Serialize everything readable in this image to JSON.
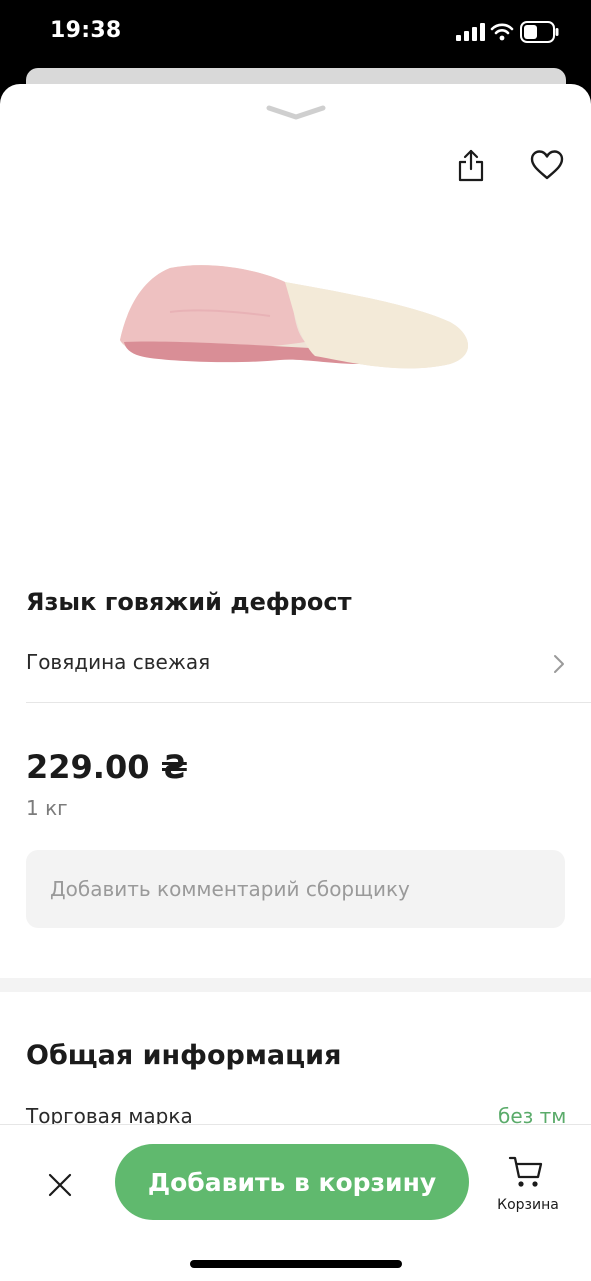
{
  "status": {
    "time": "19:38"
  },
  "product": {
    "title": "Язык говяжий дефрост",
    "category": "Говядина свежая",
    "price": "229.00 ₴",
    "unit": "1 кг",
    "comment_placeholder": "Добавить комментарий сборщику"
  },
  "info": {
    "title": "Общая информация",
    "brand_label": "Торговая марка",
    "brand_value": "без тм"
  },
  "bottom": {
    "add_to_cart": "Добавить в корзину",
    "cart_label": "Корзина"
  },
  "icons": {
    "share": "share-icon",
    "favorite": "heart-icon",
    "close": "close-icon",
    "cart": "cart-icon",
    "chevron": "chevron-right-icon"
  },
  "colors": {
    "accent": "#60b96e",
    "brand_value": "#5aab6a"
  }
}
